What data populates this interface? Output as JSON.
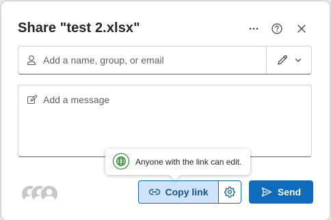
{
  "dialog": {
    "title": "Share \"test 2.xlsx\"",
    "more_icon": "more-horizontal-icon",
    "help_icon": "question-circle-icon",
    "close_icon": "dismiss-icon"
  },
  "people_picker": {
    "placeholder": "Add a name, group, or email",
    "icon": "person-icon",
    "permission_icons": [
      "pencil-icon",
      "chevron-down-icon"
    ]
  },
  "message": {
    "placeholder": "Add a message",
    "icon": "compose-icon"
  },
  "tooltip": {
    "text": "Anyone with the link can edit.",
    "icon": "globe-icon",
    "icon_color": "#107c10"
  },
  "footer": {
    "avatars_icon": "people-avatars-icon",
    "copy_link_label": "Copy link",
    "copy_link_icon": "link-icon",
    "settings_icon": "gear-icon",
    "send_label": "Send",
    "send_icon": "send-icon"
  },
  "colors": {
    "accent": "#0f6cbd",
    "copy_link_bg": "#cfe4fa",
    "copy_link_text": "#0f548c"
  }
}
